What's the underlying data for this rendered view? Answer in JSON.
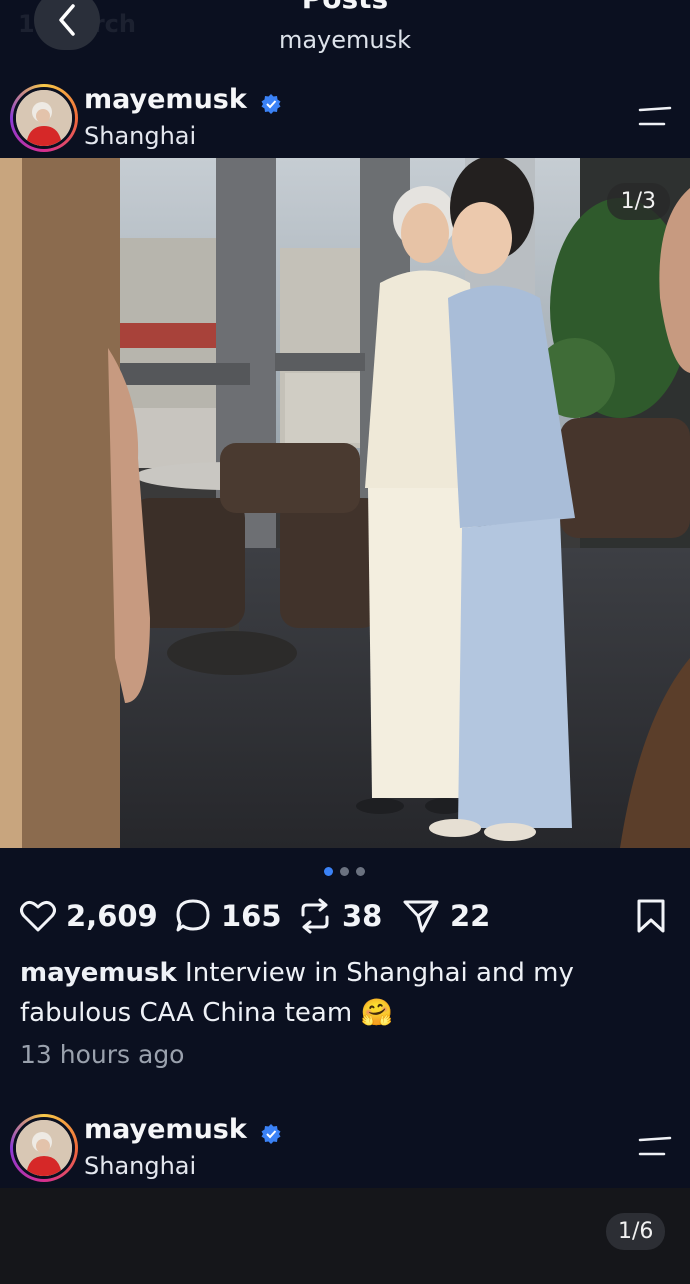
{
  "header": {
    "title": "Posts",
    "subtitle": "mayemusk",
    "ghost_search": "Search"
  },
  "post": {
    "username": "mayemusk",
    "location": "Shanghai",
    "image_counter": "1/3",
    "likes": "2,609",
    "comments": "165",
    "reposts": "38",
    "shares": "22",
    "caption_user": "mayemusk",
    "caption_text": " Interview in Shanghai and my fabulous CAA China team ",
    "caption_emoji": "🤗",
    "time": "13 hours ago",
    "dots_active": 0,
    "dots_total": 3
  },
  "post2": {
    "username": "mayemusk",
    "location": "Shanghai",
    "image_counter": "1/6"
  },
  "colors": {
    "background": "#0b1020",
    "verified": "#3b82f6",
    "dot_active": "#3b82f6",
    "dot_inactive": "#6b7280"
  },
  "icons": [
    "chevron-left-icon",
    "verified-icon",
    "menu-icon",
    "heart-icon",
    "comment-icon",
    "repost-icon",
    "share-icon",
    "bookmark-icon"
  ]
}
